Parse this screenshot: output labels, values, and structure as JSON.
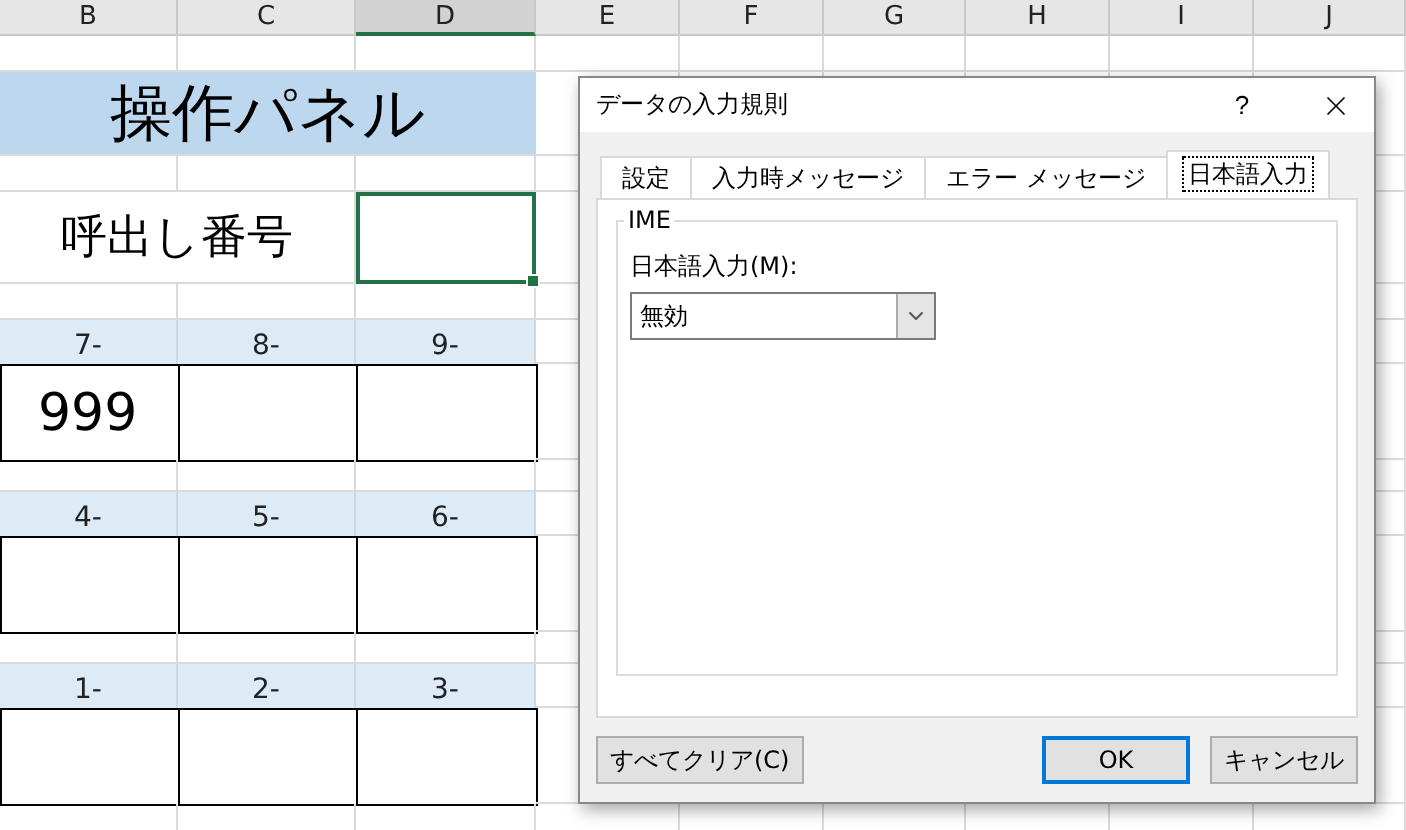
{
  "sheet": {
    "columns": [
      {
        "label": "B",
        "selected": false
      },
      {
        "label": "C",
        "selected": false
      },
      {
        "label": "D",
        "selected": true
      },
      {
        "label": "E",
        "selected": false
      },
      {
        "label": "F",
        "selected": false
      },
      {
        "label": "G",
        "selected": false
      },
      {
        "label": "H",
        "selected": false
      },
      {
        "label": "I",
        "selected": false
      },
      {
        "label": "J",
        "selected": false
      }
    ],
    "title": "操作パネル",
    "call_label": "呼出し番号",
    "call_cell": {
      "selected": true
    },
    "groups": [
      {
        "cells": [
          {
            "header": "7-",
            "value": "999"
          },
          {
            "header": "8-"
          },
          {
            "header": "9-"
          }
        ]
      },
      {
        "cells": [
          {
            "header": "4-"
          },
          {
            "header": "5-"
          },
          {
            "header": "6-"
          }
        ]
      },
      {
        "cells": [
          {
            "header": "1-"
          },
          {
            "header": "2-"
          },
          {
            "header": "3-"
          }
        ]
      }
    ]
  },
  "dialog": {
    "title": "データの入力規則",
    "help": "?",
    "tabs": [
      {
        "label": "設定",
        "selected": false
      },
      {
        "label": "入力時メッセージ",
        "selected": false
      },
      {
        "label": "エラー メッセージ",
        "selected": false
      },
      {
        "label": "日本語入力",
        "selected": true
      }
    ],
    "group": "IME",
    "field_label": "日本語入力(M):",
    "select_value": "無効",
    "buttons": [
      {
        "label": "すべてクリア(C)",
        "kind": "left",
        "default": false
      },
      {
        "label": "OK",
        "kind": "right",
        "default": true
      },
      {
        "label": "キャンセル",
        "kind": "right",
        "default": false
      }
    ]
  }
}
